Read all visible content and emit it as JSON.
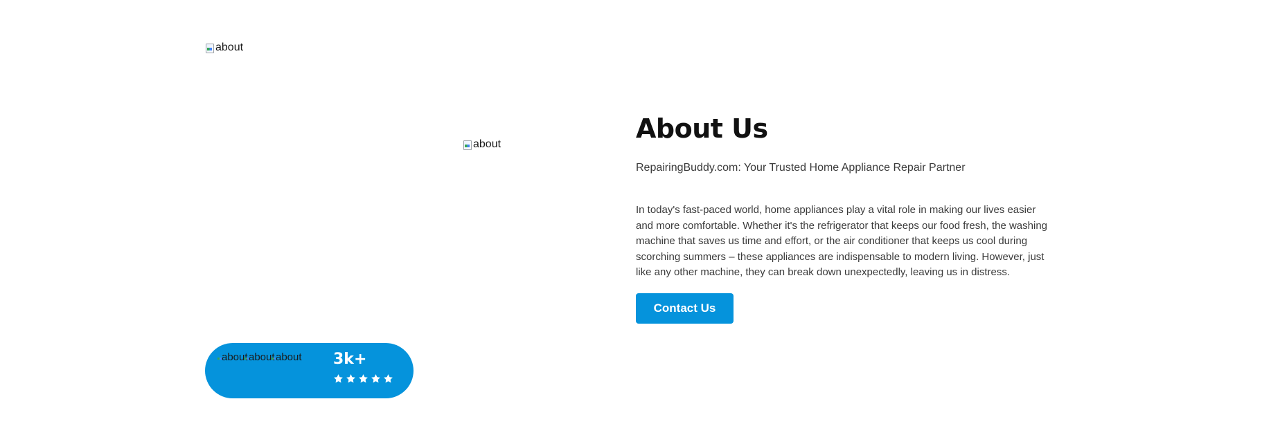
{
  "images": {
    "top_alt": "about",
    "center_alt": "about"
  },
  "about": {
    "title": "About Us",
    "subtitle": "RepairingBuddy.com: Your Trusted Home Appliance Repair Partner",
    "body": "In today's fast-paced world, home appliances play a vital role in making our lives easier and more comfortable. Whether it's the refrigerator that keeps our food fresh, the washing machine that saves us time and effort, or the air conditioner that keeps us cool during scorching summers – these appliances are indispensable to modern living. However, just like any other machine, they can break down unexpectedly, leaving us in distress.",
    "contact_label": "Contact Us"
  },
  "stats": {
    "avatar_alts": [
      "about",
      "about",
      "about"
    ],
    "count": "3k+",
    "rating": 5,
    "star_icon": "star-icon"
  },
  "colors": {
    "accent": "#0593dc",
    "text": "#3a3a3a",
    "heading": "#111111"
  }
}
